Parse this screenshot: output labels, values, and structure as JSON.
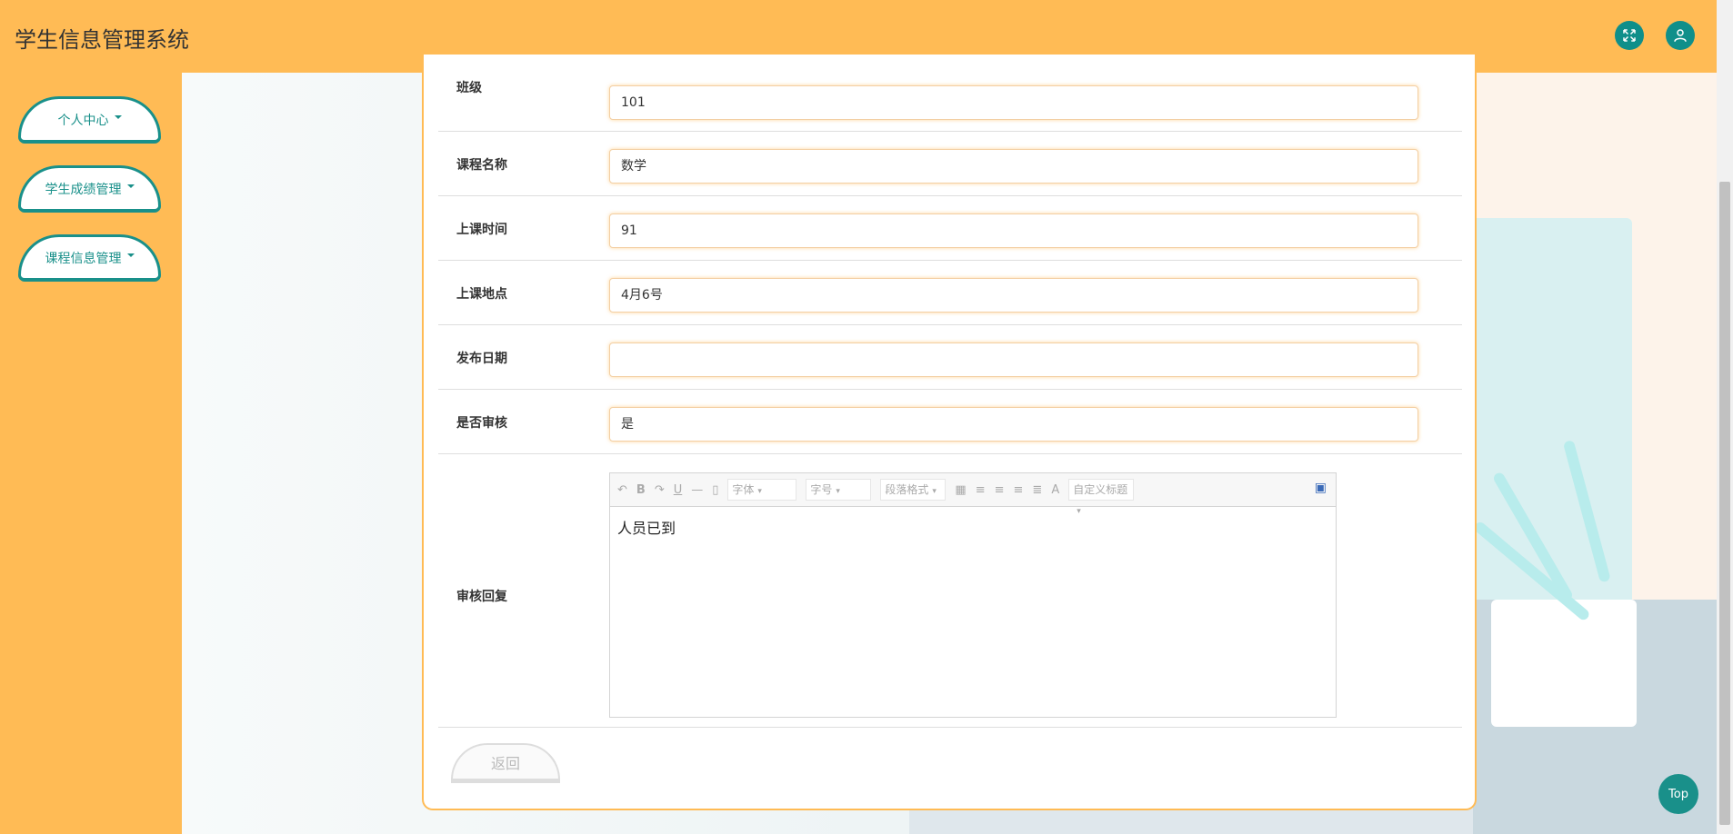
{
  "header": {
    "title": "学生信息管理系统",
    "fullscreen_icon": "expand-icon",
    "user_icon": "user-icon",
    "accent": "#ffbb55",
    "button_color": "#0f8f8a"
  },
  "sidebar": {
    "items": [
      {
        "label": "个人中心"
      },
      {
        "label": "学生成绩管理"
      },
      {
        "label": "课程信息管理"
      }
    ]
  },
  "form": {
    "fields": [
      {
        "label": "班级",
        "value": "101"
      },
      {
        "label": "课程名称",
        "value": "数学"
      },
      {
        "label": "上课时间",
        "value": "91"
      },
      {
        "label": "上课地点",
        "value": "4月6号"
      },
      {
        "label": "发布日期",
        "value": ""
      },
      {
        "label": "是否审核",
        "value": "是"
      }
    ],
    "reply_label": "审核回复",
    "reply_content": "人员已到",
    "toolbar": {
      "font_family": "字体",
      "font_size": "字号",
      "paragraph": "段落格式",
      "custom_title": "自定义标题",
      "underline": "U",
      "bold": "B",
      "font_color": "A"
    },
    "return_label": "返回"
  },
  "top_button": "Top"
}
